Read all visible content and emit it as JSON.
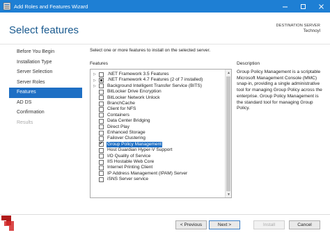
{
  "window": {
    "title": "Add Roles and Features Wizard",
    "controls": [
      "minimize-icon",
      "maximize-icon",
      "close-icon"
    ]
  },
  "header": {
    "page_title": "Select features",
    "destination_label": "DESTINATION SERVER",
    "destination_name": "Technoyl"
  },
  "nav": {
    "items": [
      {
        "label": "Before You Begin",
        "state": "normal"
      },
      {
        "label": "Installation Type",
        "state": "normal"
      },
      {
        "label": "Server Selection",
        "state": "normal"
      },
      {
        "label": "Server Roles",
        "state": "normal"
      },
      {
        "label": "Features",
        "state": "active"
      },
      {
        "label": "AD DS",
        "state": "normal"
      },
      {
        "label": "Confirmation",
        "state": "normal"
      },
      {
        "label": "Results",
        "state": "disabled"
      }
    ]
  },
  "main": {
    "instruction": "Select one or more features to install on the selected server.",
    "features_heading": "Features",
    "description_heading": "Description",
    "description_text": "Group Policy Management is a scriptable Microsoft Management Console (MMC) snap-in, providing a single administrative tool for managing Group Policy across the enterprise. Group Policy Management is the standard tool for managing Group Policy.",
    "features": [
      {
        "label": ".NET Framework 3.5 Features",
        "expandable": true,
        "state": "unchecked",
        "selected": false
      },
      {
        "label": ".NET Framework 4.7 Features (2 of 7 installed)",
        "expandable": true,
        "state": "partial",
        "selected": false
      },
      {
        "label": "Background Intelligent Transfer Service (BITS)",
        "expandable": true,
        "state": "unchecked",
        "selected": false
      },
      {
        "label": "BitLocker Drive Encryption",
        "expandable": false,
        "state": "unchecked",
        "selected": false
      },
      {
        "label": "BitLocker Network Unlock",
        "expandable": false,
        "state": "unchecked",
        "selected": false
      },
      {
        "label": "BranchCache",
        "expandable": false,
        "state": "unchecked",
        "selected": false
      },
      {
        "label": "Client for NFS",
        "expandable": false,
        "state": "unchecked",
        "selected": false
      },
      {
        "label": "Containers",
        "expandable": false,
        "state": "unchecked",
        "selected": false
      },
      {
        "label": "Data Center Bridging",
        "expandable": false,
        "state": "unchecked",
        "selected": false
      },
      {
        "label": "Direct Play",
        "expandable": false,
        "state": "unchecked",
        "selected": false
      },
      {
        "label": "Enhanced Storage",
        "expandable": false,
        "state": "unchecked",
        "selected": false
      },
      {
        "label": "Failover Clustering",
        "expandable": false,
        "state": "unchecked",
        "selected": false
      },
      {
        "label": "Group Policy Management",
        "expandable": false,
        "state": "checked",
        "selected": true
      },
      {
        "label": "Host Guardian Hyper-V Support",
        "expandable": false,
        "state": "unchecked",
        "selected": false
      },
      {
        "label": "I/O Quality of Service",
        "expandable": false,
        "state": "unchecked",
        "selected": false
      },
      {
        "label": "IIS Hostable Web Core",
        "expandable": false,
        "state": "unchecked",
        "selected": false
      },
      {
        "label": "Internet Printing Client",
        "expandable": false,
        "state": "unchecked",
        "selected": false
      },
      {
        "label": "IP Address Management (IPAM) Server",
        "expandable": false,
        "state": "unchecked",
        "selected": false
      },
      {
        "label": "iSNS Server service",
        "expandable": false,
        "state": "unchecked",
        "selected": false
      }
    ]
  },
  "footer": {
    "previous_label": "< Previous",
    "next_label": "Next >",
    "install_label": "Install",
    "cancel_label": "Cancel"
  },
  "colors": {
    "titlebar": "#1e7fd4",
    "accent": "#1e6fc4",
    "page_title": "#1a5a8f"
  }
}
